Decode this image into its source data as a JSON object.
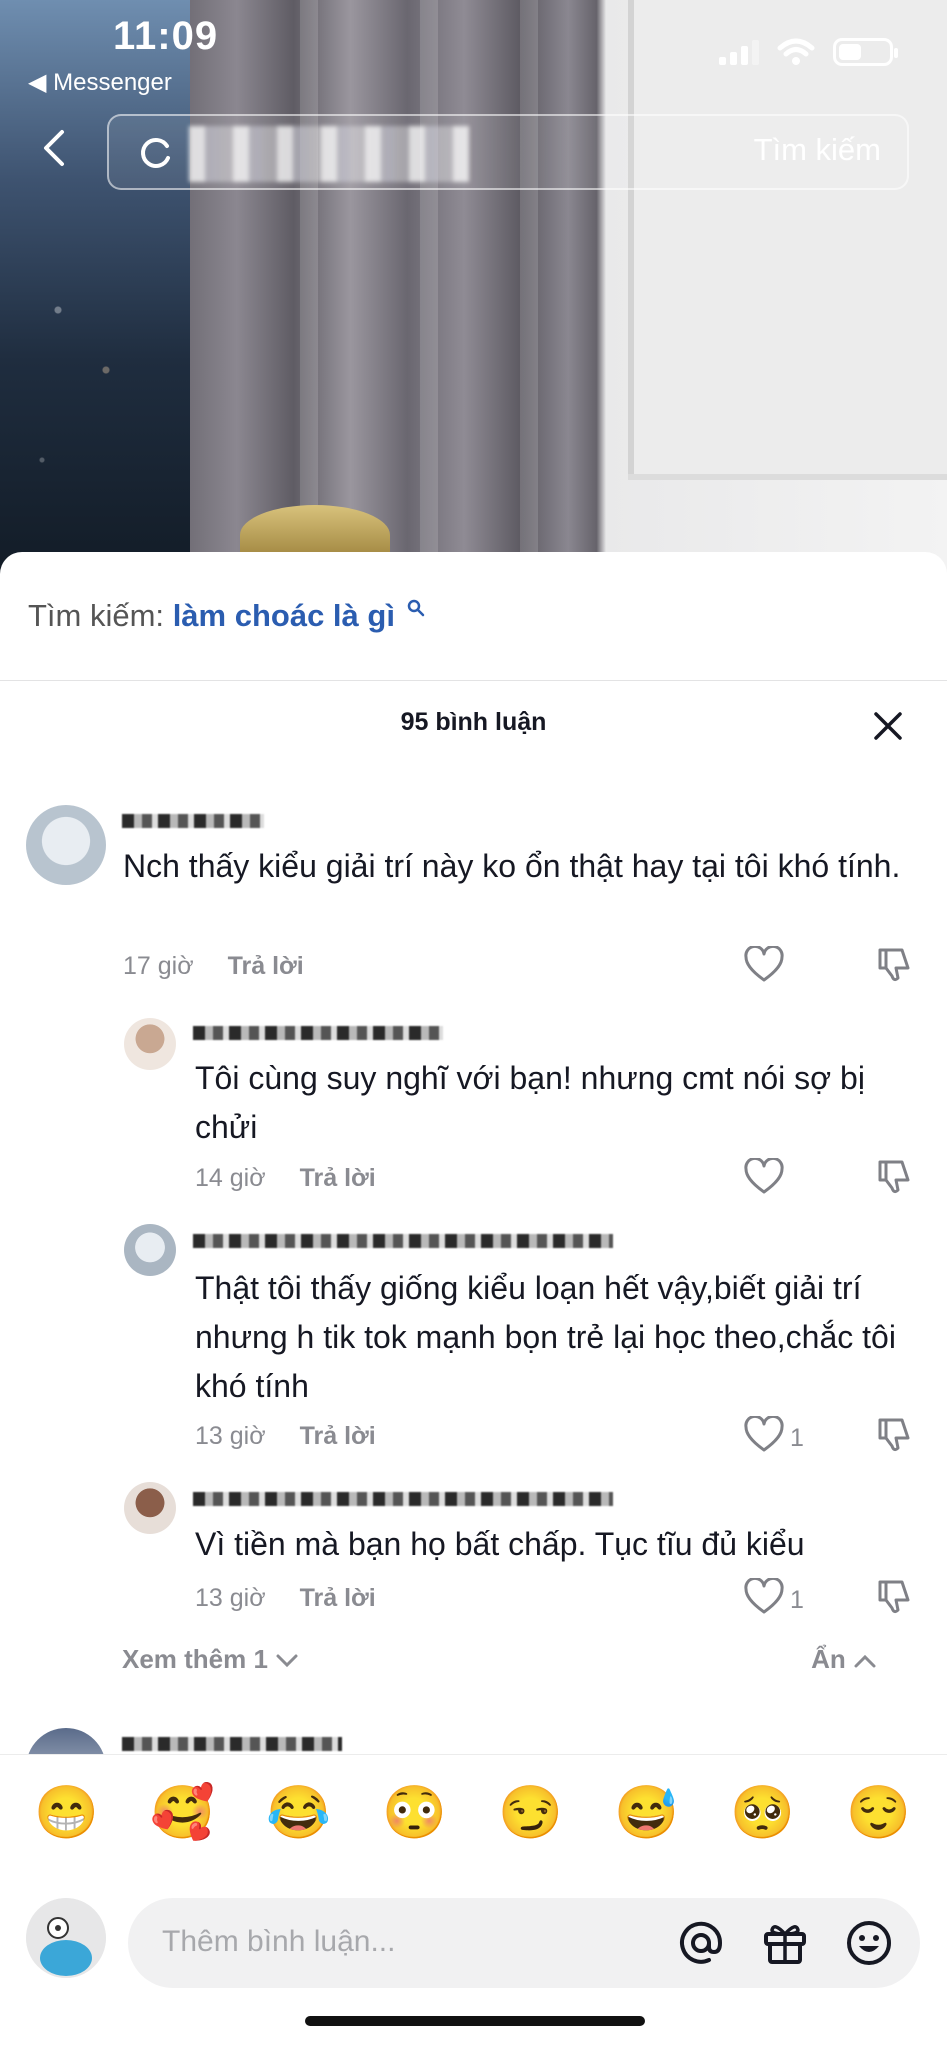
{
  "status_bar": {
    "time": "11:09",
    "back_app": "◀ Messenger"
  },
  "search": {
    "button_label": "Tìm kiếm"
  },
  "suggestion": {
    "label": "Tìm kiếm:",
    "query": "làm choác là gì"
  },
  "comments_header": {
    "count_label": "95 bình luận"
  },
  "comments": [
    {
      "text": "Nch thấy kiểu giải trí này ko ổn thật hay tại tôi khó tính.",
      "time": "17 giờ",
      "reply": "Trả lời",
      "likes": ""
    },
    {
      "text": "Tôi cùng suy nghĩ với bạn! nhưng cmt nói sợ bị chửi",
      "time": "14 giờ",
      "reply": "Trả lời",
      "likes": ""
    },
    {
      "text": "Thật tôi thấy giống kiểu loạn hết vậy,biết giải trí nhưng h tik tok mạnh bọn trẻ lại học theo,chắc tôi khó tính",
      "time": "13 giờ",
      "reply": "Trả lời",
      "likes": "1"
    },
    {
      "text": "Vì tiền mà bạn họ bất chấp. Tục tĩu đủ kiểu",
      "time": "13 giờ",
      "reply": "Trả lời",
      "likes": "1"
    }
  ],
  "thread": {
    "more_label": "Xem thêm 1",
    "hide_label": "Ẩn"
  },
  "emojis": [
    "😁",
    "🥰",
    "😂",
    "😳",
    "😏",
    "😅",
    "🥺",
    "😌"
  ],
  "composer": {
    "placeholder": "Thêm bình luận..."
  },
  "colors": {
    "link": "#2b5db0",
    "muted": "#8a8b91",
    "text": "#161823"
  }
}
